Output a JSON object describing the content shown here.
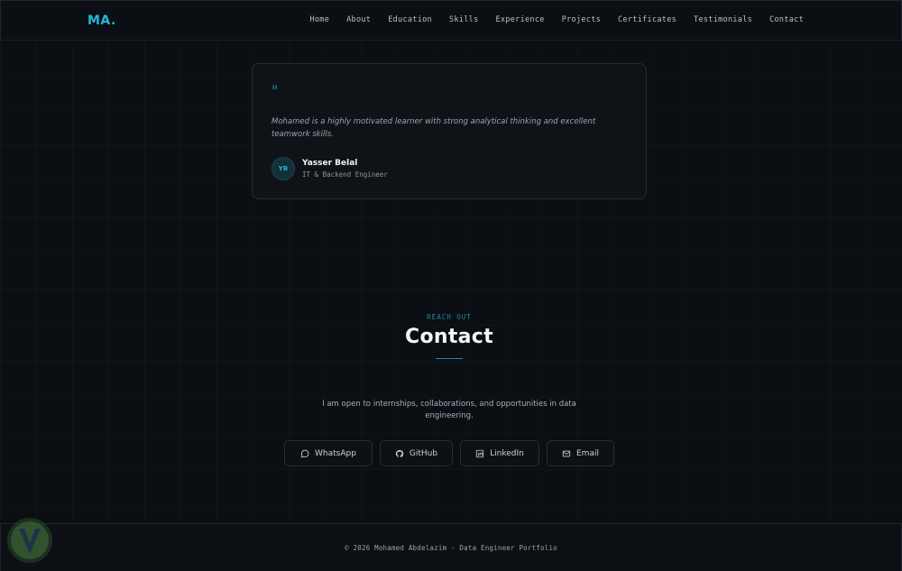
{
  "header": {
    "logo": "MA.",
    "nav": [
      "Home",
      "About",
      "Education",
      "Skills",
      "Experience",
      "Projects",
      "Certificates",
      "Testimonials",
      "Contact"
    ]
  },
  "testimonial": {
    "quote_mark": "\"",
    "text": "Mohamed is a highly motivated learner with strong analytical thinking and excellent teamwork skills.",
    "initials": "YB",
    "name": "Yasser Belal",
    "role": "IT & Backend Engineer"
  },
  "contact": {
    "eyebrow": "REACH OUT",
    "title": "Contact",
    "intro": "I am open to internships, collaborations, and opportunities in data engineering.",
    "buttons": [
      {
        "label": "WhatsApp",
        "icon": "whatsapp-icon"
      },
      {
        "label": "GitHub",
        "icon": "github-icon"
      },
      {
        "label": "LinkedIn",
        "icon": "linkedin-icon"
      },
      {
        "label": "Email",
        "icon": "mail-icon"
      }
    ]
  },
  "footer": {
    "text": "© 2026 Mohamed Abdelazim · Data Engineer Portfolio"
  },
  "colors": {
    "accent": "#22b8d8",
    "background": "#0b0e12",
    "card": "#0f1318"
  }
}
